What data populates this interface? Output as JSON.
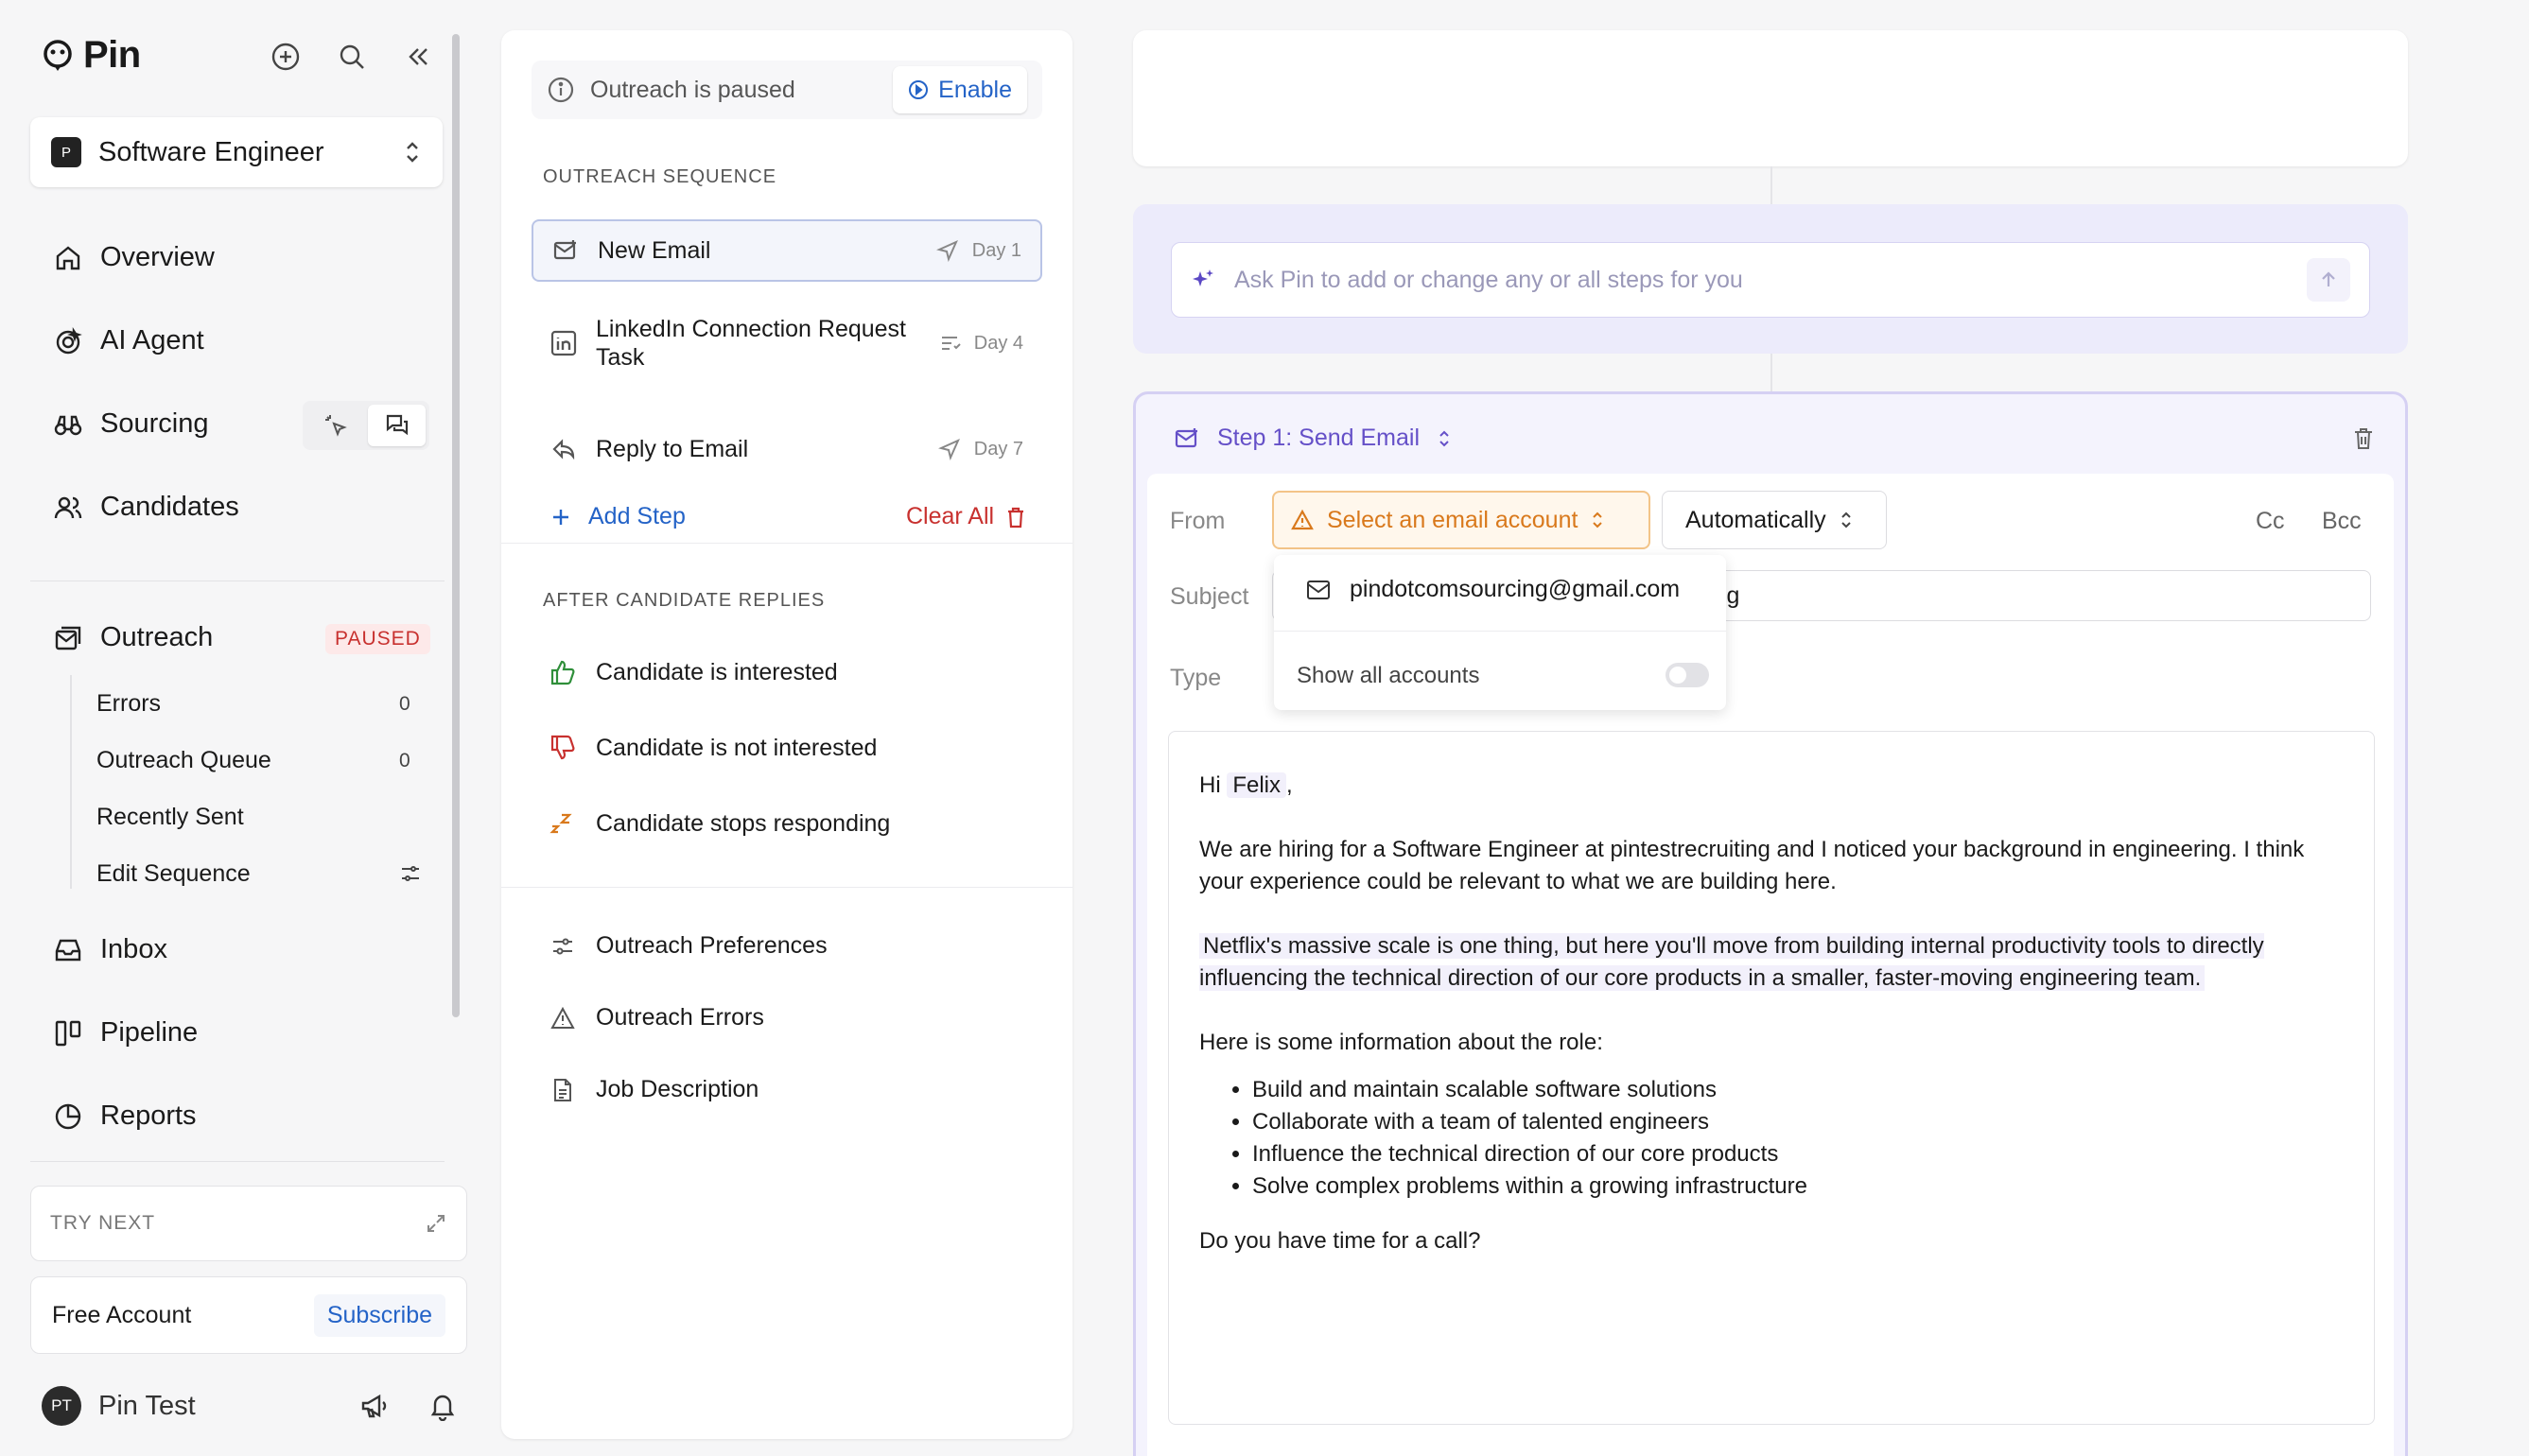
{
  "app": {
    "name": "Pin"
  },
  "sidebar": {
    "job": {
      "badge": "P",
      "name": "Software Engineer"
    },
    "nav": {
      "overview": "Overview",
      "ai_agent": "AI Agent",
      "sourcing": "Sourcing",
      "candidates": "Candidates",
      "outreach": "Outreach",
      "outreach_badge": "PAUSED",
      "inbox": "Inbox",
      "pipeline": "Pipeline",
      "reports": "Reports"
    },
    "outreach_sub": {
      "errors": "Errors",
      "errors_count": "0",
      "queue": "Outreach Queue",
      "queue_count": "0",
      "recent": "Recently Sent",
      "edit": "Edit Sequence"
    },
    "try_next": "TRY NEXT",
    "account": {
      "label": "Free Account",
      "action": "Subscribe"
    },
    "user": {
      "initials": "PT",
      "name": "Pin Test"
    }
  },
  "sequence": {
    "paused_text": "Outreach is paused",
    "enable": "Enable",
    "section_title": "OUTREACH SEQUENCE",
    "steps": [
      {
        "label": "New Email",
        "day": "Day 1"
      },
      {
        "label": "LinkedIn Connection Request Task",
        "day": "Day 4"
      },
      {
        "label": "Reply to Email",
        "day": "Day 7"
      }
    ],
    "add_step": "Add Step",
    "clear_all": "Clear All",
    "replies_title": "AFTER CANDIDATE REPLIES",
    "replies": [
      "Candidate is interested",
      "Candidate is not interested",
      "Candidate stops responding"
    ],
    "links": [
      "Outreach Preferences",
      "Outreach Errors",
      "Job Description"
    ]
  },
  "assistant": {
    "placeholder": "Ask Pin to add or change any or all steps for you"
  },
  "step": {
    "title": "Step 1: Send Email",
    "from_label": "From",
    "account_select": "Select an email account",
    "schedule": "Automatically",
    "cc": "Cc",
    "bcc": "Bcc",
    "subject_label": "Subject",
    "subject_visible": "ing",
    "type_label": "Type",
    "dropdown": {
      "option": "pindotcomsourcing@gmail.com",
      "show_all": "Show all accounts"
    },
    "body": {
      "greeting_pre": "Hi",
      "greeting_name": "Felix",
      "greeting_post": ",",
      "p1": "We are hiring for a Software Engineer at pintestrecruiting and I noticed your background in engineering. I think your experience could be relevant to what we are building here.",
      "p2": "Netflix's massive scale is one thing, but here you'll move from building internal productivity tools to directly influencing the technical direction of our core products in a smaller, faster-moving engineering team.",
      "p3": "Here is some information about the role:",
      "bullets": [
        "Build and maintain scalable software solutions",
        "Collaborate with a team of talented engineers",
        "Influence the technical direction of our core products",
        "Solve complex problems within a growing infrastructure"
      ],
      "closing": "Do you have time for a call?"
    }
  },
  "colors": {
    "accent_blue": "#2463c7",
    "danger_red": "#c8312f",
    "warning_orange": "#d9791c",
    "ai_purple": "#6550c8",
    "success_green": "#2f8f3a"
  }
}
